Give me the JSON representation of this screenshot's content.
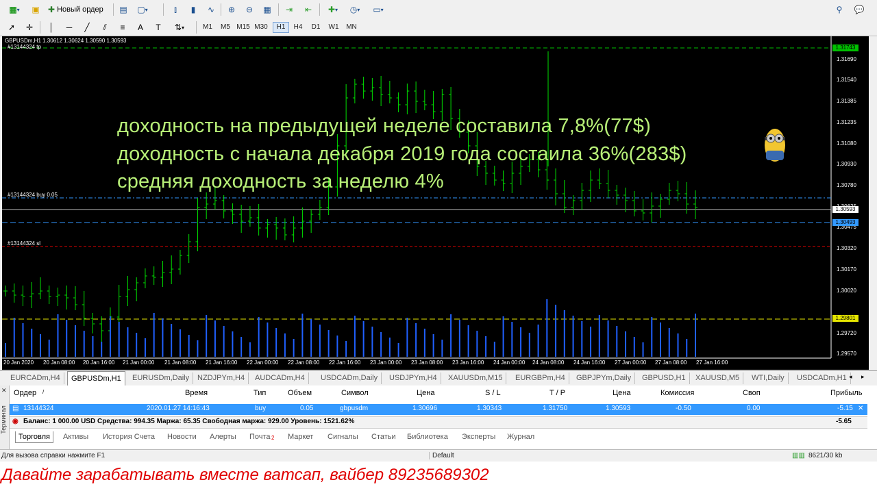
{
  "toolbar1": {
    "new_order_label": "Новый ордер"
  },
  "toolbar2": {
    "timeframes": [
      "M1",
      "M5",
      "M15",
      "M30",
      "H1",
      "H4",
      "D1",
      "W1",
      "MN"
    ],
    "active_timeframe": "H1"
  },
  "chart": {
    "header": "GBPUSDm,H1  1.30612 1.30624 1.30590 1.30593",
    "order_tp_label": "#13144324 tp",
    "order_buy_label": "#13144324 buy 0.05",
    "order_sl_label": "#13144324 sl",
    "overlay_lines": [
      "доходность на предыдущей неделе составила 7,8%(77$)",
      "доходность с начала декабря 2019 года состаила 36%(283$)",
      "средняя доходность за неделю 4%"
    ],
    "price_ticks": [
      "1.31690",
      "1.31540",
      "1.31385",
      "1.31235",
      "1.31080",
      "1.30930",
      "1.30780",
      "1.30625",
      "1.30475",
      "1.30320",
      "1.30170",
      "1.30020",
      "1.29720",
      "1.29570"
    ],
    "price_tags": {
      "tp": "1.31743",
      "current": "1.30593",
      "buy": "1.30493",
      "yellow": "1.29801"
    },
    "time_ticks": [
      "20 Jan 2020",
      "20 Jan 08:00",
      "20 Jan 16:00",
      "21 Jan 00:00",
      "21 Jan 08:00",
      "21 Jan 16:00",
      "22 Jan 00:00",
      "22 Jan 08:00",
      "22 Jan 16:00",
      "23 Jan 00:00",
      "23 Jan 08:00",
      "23 Jan 16:00",
      "24 Jan 00:00",
      "24 Jan 08:00",
      "24 Jan 16:00",
      "27 Jan 00:00",
      "27 Jan 08:00",
      "27 Jan 16:00"
    ]
  },
  "chart_tabs": [
    "EURCADm,H4",
    "GBPUSDm,H1",
    "EURUSDm,Daily",
    "NZDJPYm,H4",
    "AUDCADm,H4",
    "USDCADm,Daily",
    "USDJPYm,H4",
    "XAUUSDm,M15",
    "EURGBPm,H4",
    "GBPJPYm,Daily",
    "GBPUSD,H1",
    "XAUUSD,M5",
    "WTI,Daily",
    "USDCADm,H1"
  ],
  "terminal": {
    "side_label": "Терминал",
    "headers": {
      "order": "Ордер",
      "time": "Время",
      "type": "Тип",
      "volume": "Объем",
      "symbol": "Символ",
      "price": "Цена",
      "sl": "S / L",
      "tp": "T / P",
      "price2": "Цена",
      "commission": "Комиссия",
      "swap": "Своп",
      "profit": "Прибыль"
    },
    "row": {
      "order": "13144324",
      "time": "2020.01.27 14:16:43",
      "type": "buy",
      "volume": "0.05",
      "symbol": "gbpusdm",
      "price": "1.30696",
      "sl": "1.30343",
      "tp": "1.31750",
      "price2": "1.30593",
      "commission": "-0.50",
      "swap": "0.00",
      "profit": "-5.15"
    },
    "balance_text": "Баланс: 1 000.00 USD  Средства: 994.35  Маржа: 65.35  Свободная маржа: 929.00  Уровень: 1521.62%",
    "balance_profit": "-5.65",
    "tabs": [
      "Торговля",
      "Активы",
      "История Счета",
      "Новости",
      "Алерты",
      "Почта",
      "Маркет",
      "Сигналы",
      "Статьи",
      "Библиотека",
      "Эксперты",
      "Журнал"
    ],
    "mail_badge": "2"
  },
  "status": {
    "help": "Для вызова справки нажмите F1",
    "profile": "Default",
    "traffic": "8621/30 kb"
  },
  "banner": {
    "text": "Давайте зарабатывать вместе ватсап, вайбер 89235689302"
  }
}
